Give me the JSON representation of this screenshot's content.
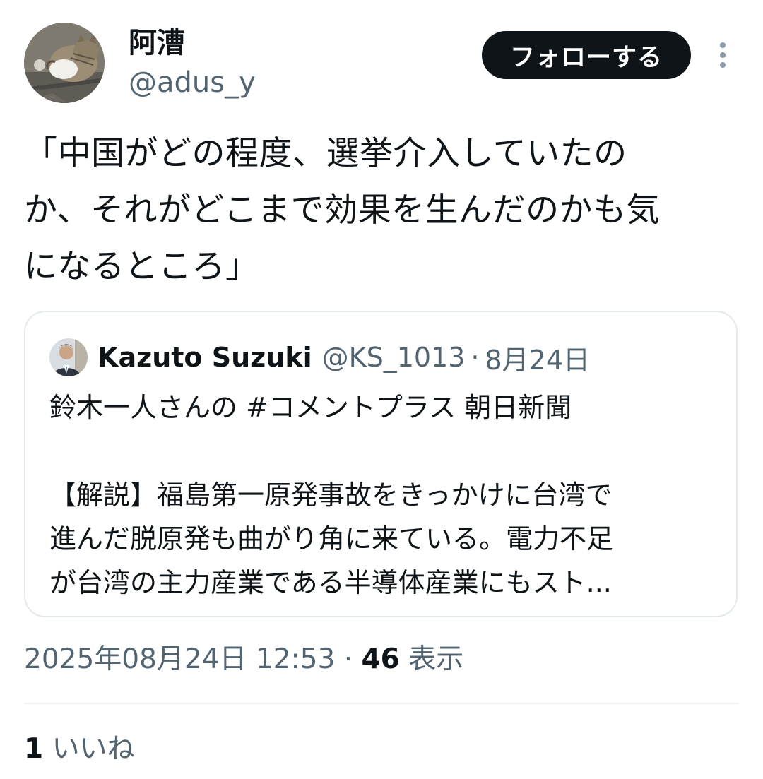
{
  "author": {
    "display_name": "阿漕",
    "handle": "@adus_y"
  },
  "actions": {
    "follow_label": "フォローする"
  },
  "tweet": {
    "lines": [
      "「中国がどの程度、選挙介入していたの",
      "か、それがどこまで効果を生んだのかも気",
      "になるところ」"
    ]
  },
  "quote": {
    "author_name": "Kazuto Suzuki",
    "author_handle": "@KS_1013",
    "separator": "·",
    "date": "8月24日",
    "lines": [
      "鈴木一人さんの #コメントプラス 朝日新聞",
      "",
      "【解説】福島第一原発事故をきっかけに台湾で",
      "進んだ脱原発も曲がり角に来ている。電力不足",
      "が台湾の主力産業である半導体産業にもスト..."
    ]
  },
  "meta": {
    "timestamp": "2025年08月24日 12:53",
    "separator": "·",
    "views_count": "46",
    "views_label": "表示"
  },
  "engagement": {
    "likes_count": "1",
    "likes_label": "いいね"
  },
  "colors": {
    "text_primary": "#0f1419",
    "text_secondary": "#536471",
    "follow_button_bg": "#0f1419",
    "border": "#e4e9ec"
  }
}
